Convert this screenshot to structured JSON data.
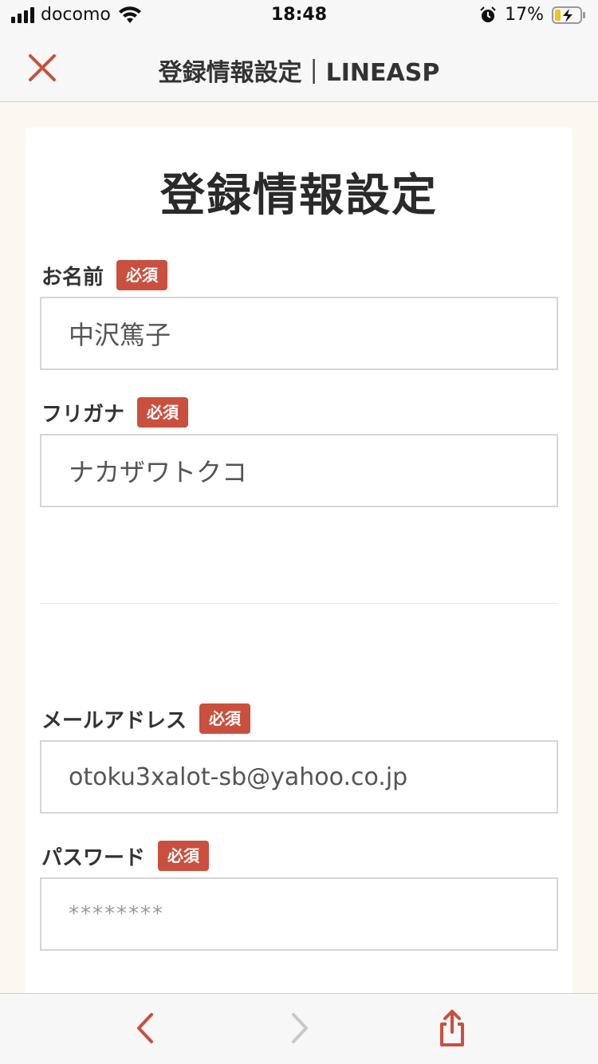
{
  "status_bar": {
    "carrier": "docomo",
    "time": "18:48",
    "battery_percent": "17%"
  },
  "nav": {
    "title": "登録情報設定｜LINEASP",
    "close_icon": "close-icon"
  },
  "form": {
    "title": "登録情報設定",
    "required_label": "必須",
    "fields": [
      {
        "label": "お名前",
        "value": "中沢篤子"
      },
      {
        "label": "フリガナ",
        "value": "ナカザワトクコ"
      },
      {
        "label": "メールアドレス",
        "value": "otoku3xalot-sb@yahoo.co.jp"
      },
      {
        "label": "パスワード",
        "value": "********"
      }
    ]
  },
  "toolbar": {
    "back_icon": "chevron-left-icon",
    "forward_icon": "chevron-right-icon",
    "share_icon": "share-icon"
  },
  "colors": {
    "accent": "#c9503e",
    "background": "#fbf8f2",
    "forward_disabled": "#c8c8c8"
  }
}
